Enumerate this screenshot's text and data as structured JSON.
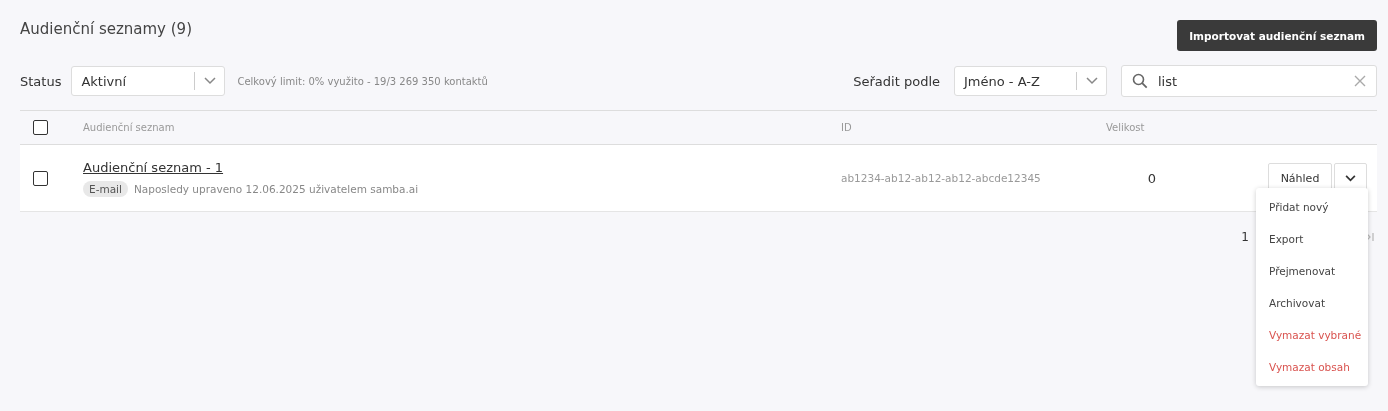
{
  "title": "Audienční seznamy (9)",
  "import_button": "Importovat audienční seznam",
  "status_filter": {
    "label": "Status",
    "value": "Aktivní"
  },
  "limit_note": "Celkový limit: 0% využito - 19/3 269 350 kontaktů",
  "sort": {
    "label": "Seřadit podle",
    "value": "Jméno - A-Z"
  },
  "search": {
    "value": "list"
  },
  "table": {
    "header_checked": false,
    "columns": [
      "Audienční seznam",
      "ID",
      "Velikost"
    ],
    "rows": [
      {
        "checked": false,
        "name": "Audienční seznam - 1",
        "tag": "E-mail",
        "note": "Naposledy upraveno 12.06.2025 uživatelem samba.ai",
        "id": "ab1234-ab12-ab12-ab12-abcde12345",
        "size": "0",
        "action": "Náhled"
      }
    ]
  },
  "pagination": {
    "page": "1"
  },
  "menu": [
    {
      "label": "Přidat nový",
      "kind": "default"
    },
    {
      "label": "Export",
      "kind": "default"
    },
    {
      "label": "Přejmenovat",
      "kind": "default"
    },
    {
      "label": "Archivovat",
      "kind": "default"
    },
    {
      "label": "Vymazat vybrané",
      "kind": "danger"
    },
    {
      "label": "Vymazat obsah",
      "kind": "danger"
    }
  ]
}
